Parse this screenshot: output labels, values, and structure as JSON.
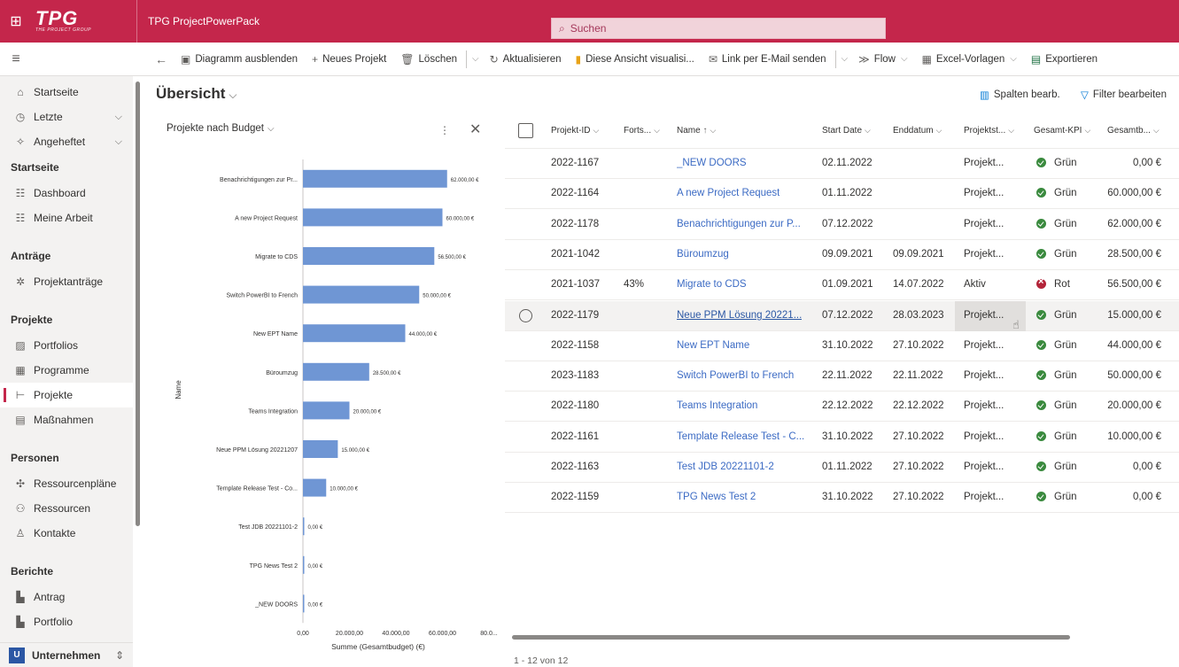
{
  "app": {
    "logo_big": "TPG",
    "logo_small": "THE PROJECT GROUP",
    "title": "TPG ProjectPowerPack",
    "search_placeholder": "Suchen"
  },
  "commands": [
    {
      "label": "Diagramm ausblenden",
      "icon": "chart-icon"
    },
    {
      "label": "Neues Projekt",
      "icon": "plus-icon"
    },
    {
      "label": "Löschen",
      "icon": "trash-icon"
    },
    {
      "label": "Aktualisieren",
      "icon": "refresh-icon"
    },
    {
      "label": "Diese Ansicht visualisi...",
      "icon": "powerbi-icon"
    },
    {
      "label": "Link per E-Mail senden",
      "icon": "mail-link-icon"
    },
    {
      "label": "Flow",
      "icon": "flow-icon"
    },
    {
      "label": "Excel-Vorlagen",
      "icon": "excel-icon"
    },
    {
      "label": "Exportieren",
      "icon": "export-icon"
    }
  ],
  "sidebar": {
    "top": [
      {
        "label": "Startseite",
        "icon": "home-icon"
      },
      {
        "label": "Letzte",
        "icon": "clock-icon"
      },
      {
        "label": "Angeheftet",
        "icon": "pin-icon"
      }
    ],
    "groups": [
      {
        "title": "Startseite",
        "items": [
          {
            "label": "Dashboard",
            "icon": "dashboard-icon"
          },
          {
            "label": "Meine Arbeit",
            "icon": "work-icon"
          }
        ]
      },
      {
        "title": "Anträge",
        "items": [
          {
            "label": "Projektanträge",
            "icon": "request-icon"
          }
        ]
      },
      {
        "title": "Projekte",
        "items": [
          {
            "label": "Portfolios",
            "icon": "portfolio-icon"
          },
          {
            "label": "Programme",
            "icon": "program-icon"
          },
          {
            "label": "Projekte",
            "icon": "project-icon"
          },
          {
            "label": "Maßnahmen",
            "icon": "measure-icon"
          }
        ]
      },
      {
        "title": "Personen",
        "items": [
          {
            "label": "Ressourcenpläne",
            "icon": "resource-plan-icon"
          },
          {
            "label": "Ressourcen",
            "icon": "resources-icon"
          },
          {
            "label": "Kontakte",
            "icon": "contact-icon"
          }
        ]
      },
      {
        "title": "Berichte",
        "items": [
          {
            "label": "Antrag",
            "icon": "report-icon"
          },
          {
            "label": "Portfolio",
            "icon": "report-icon"
          }
        ]
      }
    ],
    "area_badge": "U",
    "area_label": "Unternehmen"
  },
  "view": {
    "title": "Übersicht",
    "edit_columns": "Spalten bearb.",
    "edit_filters": "Filter bearbeiten"
  },
  "chart_data": {
    "type": "bar",
    "orientation": "horizontal",
    "title": "Projekte nach Budget",
    "xlabel": "Summe (Gesamtbudget) (€)",
    "ylabel": "Name",
    "categories": [
      "Benachrichtigungen zur Pr...",
      "A new Project Request",
      "Migrate to CDS",
      "Switch PowerBI to French",
      "New EPT Name",
      "Büroumzug",
      "Teams Integration",
      "Neue PPM Lösung 20221207",
      "Template Release Test - Co...",
      "Test JDB 20221101-2",
      "TPG News Test 2",
      "_NEW DOORS"
    ],
    "values": [
      62000,
      60000,
      56500,
      50000,
      44000,
      28500,
      20000,
      15000,
      10000,
      0,
      0,
      0
    ],
    "value_labels": [
      "62.000,00 €",
      "60.000,00 €",
      "56.500,00 €",
      "50.000,00 €",
      "44.000,00 €",
      "28.500,00 €",
      "20.000,00 €",
      "15.000,00 €",
      "10.000,00 €",
      "0,00 €",
      "0,00 €",
      "0,00 €"
    ],
    "xticks": [
      "0,00",
      "20.000,00",
      "40.000,00",
      "60.000,00",
      "80.0..."
    ],
    "xlim": [
      0,
      80000
    ],
    "color": "#6f96d4"
  },
  "grid": {
    "headers": [
      "Projekt-ID",
      "Forts...",
      "Name",
      "Start Date",
      "Enddatum",
      "Projektst...",
      "Gesamt-KPI",
      "Gesamtb..."
    ],
    "name_sort_arrow": "↑",
    "rows": [
      {
        "id": "2022-1167",
        "progress": "",
        "name": "_NEW DOORS",
        "start": "02.11.2022",
        "end": "",
        "status": "Projekt...",
        "kpi": "Grün",
        "kpi_color": "green",
        "budget": "0,00 €"
      },
      {
        "id": "2022-1164",
        "progress": "",
        "name": "A new Project Request",
        "start": "01.11.2022",
        "end": "",
        "status": "Projekt...",
        "kpi": "Grün",
        "kpi_color": "green",
        "budget": "60.000,00 €"
      },
      {
        "id": "2022-1178",
        "progress": "",
        "name": "Benachrichtigungen zur P...",
        "start": "07.12.2022",
        "end": "",
        "status": "Projekt...",
        "kpi": "Grün",
        "kpi_color": "green",
        "budget": "62.000,00 €"
      },
      {
        "id": "2021-1042",
        "progress": "",
        "name": "Büroumzug",
        "start": "09.09.2021",
        "end": "09.09.2021",
        "status": "Projekt...",
        "kpi": "Grün",
        "kpi_color": "green",
        "budget": "28.500,00 €"
      },
      {
        "id": "2021-1037",
        "progress": "43%",
        "name": "Migrate to CDS",
        "start": "01.09.2021",
        "end": "14.07.2022",
        "status": "Aktiv",
        "kpi": "Rot",
        "kpi_color": "red",
        "budget": "56.500,00 €"
      },
      {
        "id": "2022-1179",
        "progress": "",
        "name": "Neue PPM Lösung 20221...",
        "start": "07.12.2022",
        "end": "28.03.2023",
        "status": "Projekt...",
        "kpi": "Grün",
        "kpi_color": "green",
        "budget": "15.000,00 €"
      },
      {
        "id": "2022-1158",
        "progress": "",
        "name": "New EPT Name",
        "start": "31.10.2022",
        "end": "27.10.2022",
        "status": "Projekt...",
        "kpi": "Grün",
        "kpi_color": "green",
        "budget": "44.000,00 €"
      },
      {
        "id": "2023-1183",
        "progress": "",
        "name": "Switch PowerBI to French",
        "start": "22.11.2022",
        "end": "22.11.2022",
        "status": "Projekt...",
        "kpi": "Grün",
        "kpi_color": "green",
        "budget": "50.000,00 €"
      },
      {
        "id": "2022-1180",
        "progress": "",
        "name": "Teams Integration",
        "start": "22.12.2022",
        "end": "22.12.2022",
        "status": "Projekt...",
        "kpi": "Grün",
        "kpi_color": "green",
        "budget": "20.000,00 €"
      },
      {
        "id": "2022-1161",
        "progress": "",
        "name": "Template Release Test - C...",
        "start": "31.10.2022",
        "end": "27.10.2022",
        "status": "Projekt...",
        "kpi": "Grün",
        "kpi_color": "green",
        "budget": "10.000,00 €"
      },
      {
        "id": "2022-1163",
        "progress": "",
        "name": "Test JDB 20221101-2",
        "start": "01.11.2022",
        "end": "27.10.2022",
        "status": "Projekt...",
        "kpi": "Grün",
        "kpi_color": "green",
        "budget": "0,00 €"
      },
      {
        "id": "2022-1159",
        "progress": "",
        "name": "TPG News Test 2",
        "start": "31.10.2022",
        "end": "27.10.2022",
        "status": "Projekt...",
        "kpi": "Grün",
        "kpi_color": "green",
        "budget": "0,00 €"
      }
    ],
    "pager": "1 - 12 von 12"
  }
}
